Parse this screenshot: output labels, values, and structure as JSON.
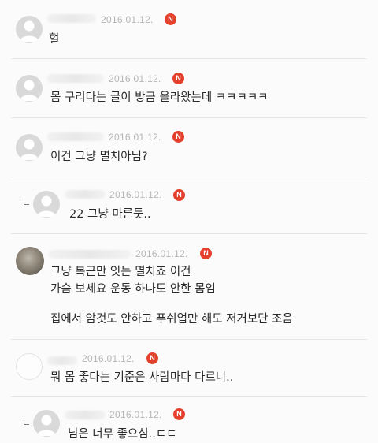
{
  "colors": {
    "badge": "#e4412c",
    "date": "#b5b5b5",
    "text": "#2a2a2a",
    "divider": "#e4e4e4"
  },
  "badge_label": "N",
  "comments": [
    {
      "date": "2016.01.12.",
      "lines": [
        "헐"
      ],
      "reply": false,
      "avatar": "default-avatar-icon"
    },
    {
      "date": "2016.01.12.",
      "lines": [
        "몸 구리다는 글이 방금 올라왔는데 ㅋㅋㅋㅋㅋ"
      ],
      "reply": false,
      "avatar": "default-avatar-icon"
    },
    {
      "date": "2016.01.12.",
      "lines": [
        "이건 그냥 멸치아님?"
      ],
      "reply": false,
      "avatar": "default-avatar-icon"
    },
    {
      "date": "2016.01.12.",
      "lines": [
        "22 그냥 마른듯.."
      ],
      "reply": true,
      "avatar": "default-avatar-icon"
    },
    {
      "date": "2016.01.12.",
      "lines": [
        "그냥 복근만 잇는 멸치죠 이건",
        "가슴 보세요 운동 하나도 안한 몸임",
        "",
        "집에서 암것도 안하고 푸쉬업만 해도 저거보단 조음"
      ],
      "reply": false,
      "avatar": "photo-avatar"
    },
    {
      "date": "2016.01.12.",
      "lines": [
        "뭐 몸 좋다는 기준은 사람마다 다르니.."
      ],
      "reply": false,
      "avatar": "blank-avatar"
    },
    {
      "date": "2016.01.12.",
      "lines": [
        "님은 너무 좋으심..ㄷㄷ"
      ],
      "reply": true,
      "avatar": "default-avatar-icon"
    }
  ]
}
